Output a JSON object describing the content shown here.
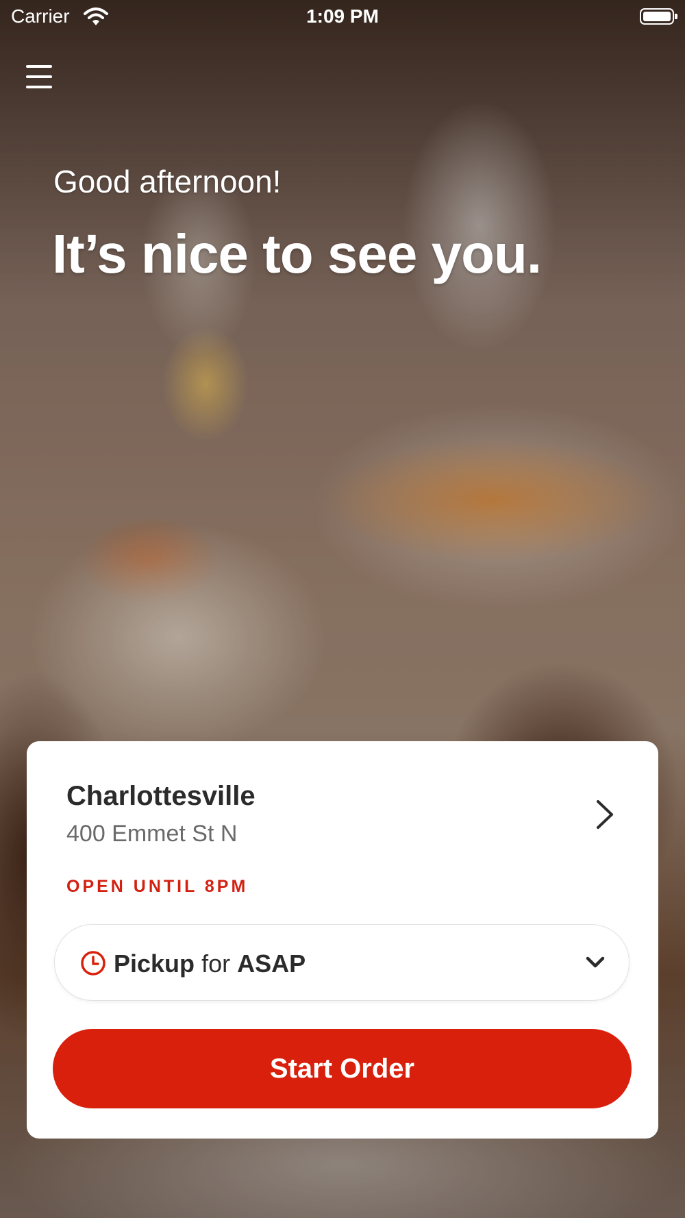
{
  "status_bar": {
    "carrier": "Carrier",
    "time": "1:09 PM"
  },
  "hero": {
    "greeting": "Good afternoon!",
    "headline": "It’s nice to see you."
  },
  "location": {
    "name": "Charlottesville",
    "address": "400 Emmet St N",
    "status": "OPEN UNTIL 8PM"
  },
  "order_mode": {
    "mode": "Pickup",
    "connector": "for",
    "when": "ASAP"
  },
  "start_order_label": "Start Order",
  "colors": {
    "accent": "#d9200c",
    "open_status": "#d32011",
    "card_background": "#ffffff"
  },
  "icons": [
    "menu-icon",
    "wifi-icon",
    "battery-icon",
    "chevron-right-icon",
    "clock-icon",
    "chevron-down-icon"
  ]
}
